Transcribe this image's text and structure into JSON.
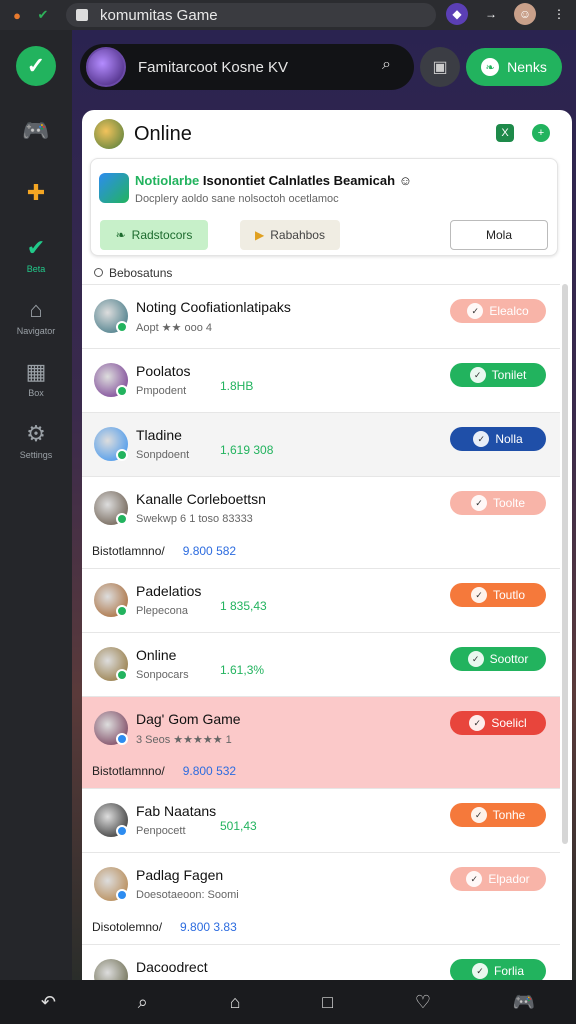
{
  "browser": {
    "url": "komumitas Game",
    "icons": [
      "fox-icon",
      "bird-icon",
      "lock-icon",
      "extension-icon",
      "forward-icon",
      "profile-icon",
      "kebab-icon"
    ]
  },
  "rail": {
    "items": [
      {
        "label": "",
        "icon": "check-icon"
      },
      {
        "label": "",
        "icon": "gamepad-icon"
      },
      {
        "label": "",
        "icon": "puzzle-icon"
      },
      {
        "label": "Beta",
        "icon": "check-mark-icon"
      },
      {
        "label": "Navigator",
        "icon": "home-icon"
      },
      {
        "label": "Box",
        "icon": "grid-icon"
      },
      {
        "label": "Settings",
        "icon": "gear-icon"
      }
    ]
  },
  "header": {
    "title": "Famitarcoot Kosne KV",
    "action_label": "Nenks"
  },
  "panel": {
    "title": "Online",
    "notice": {
      "title_prefix": "Notiolarbe",
      "title_rest": " Isonontiet Calnlatles Beamicah",
      "subtitle": "Docplery aoldo sane nolsoctoh ocetlamoc",
      "btn1": "Radstocors",
      "btn2": "Rabahbos",
      "btn3": "Mola"
    },
    "section_label": "Bebosatuns"
  },
  "rows": [
    {
      "title": "Noting Coofiationlatipaks",
      "sub": "Aopt ★★ ooo 4",
      "num": "",
      "btn": "Elealco",
      "btn_color": "#f8b4a8",
      "badge": "#22b35e",
      "icon": "#2e6b7a",
      "extra_label": "",
      "extra_val": "",
      "hl": ""
    },
    {
      "title": "Poolatos",
      "sub": "Pmpodent",
      "num": "1.8HB",
      "btn": "Tonilet",
      "btn_color": "#22b35e",
      "badge": "#22b35e",
      "icon": "#6b2a8a",
      "extra_label": "",
      "extra_val": "",
      "hl": ""
    },
    {
      "title": "Tladine",
      "sub": "Sonpdoent",
      "num": "1,619 308",
      "btn": "Nolla",
      "btn_color": "#1f4fa8",
      "badge": "#22b35e",
      "icon": "#2d8cf0",
      "extra_label": "",
      "extra_val": "",
      "hl": "grey"
    },
    {
      "title": "Kanalle Corleboettsn",
      "sub": "Swekwp 6 1 toso 83333",
      "num": "",
      "btn": "Toolte",
      "btn_color": "#f8b4a8",
      "badge": "#22b35e",
      "icon": "#5a4a3a",
      "extra_label": "Bistotlamnno/",
      "extra_val": "9.800 582",
      "hl": ""
    },
    {
      "title": "Padelatios",
      "sub": "Plepecona",
      "num": "1 835,43",
      "btn": "Toutlo",
      "btn_color": "#f5793b",
      "badge": "#22b35e",
      "icon": "#a05a20",
      "extra_label": "",
      "extra_val": "",
      "hl": ""
    },
    {
      "title": "Online",
      "sub": "Sonpocars",
      "num": "1.61,3%",
      "btn": "Soottor",
      "btn_color": "#22b35e",
      "badge": "#22b35e",
      "icon": "#8a6a2a",
      "extra_label": "",
      "extra_val": "",
      "hl": ""
    },
    {
      "title": "Dag' Gom Game",
      "sub": "3 Seos ★★★★★ 1",
      "num": "",
      "btn": "Soelicl",
      "btn_color": "#e8453c",
      "badge": "#2d8cf0",
      "icon": "#6a2a4a",
      "extra_label": "Bistotlamnno/",
      "extra_val": "9.800 532",
      "hl": "hl"
    },
    {
      "title": "Fab Naatans",
      "sub": "Penpocett",
      "num": "501,43",
      "btn": "Tonhe",
      "btn_color": "#f5793b",
      "badge": "#2d8cf0",
      "icon": "#1a1a1a",
      "extra_label": "",
      "extra_val": "",
      "hl": ""
    },
    {
      "title": "Padlag Fagen",
      "sub": "Doesotaeoon: Soomi",
      "num": "",
      "btn": "Elpador",
      "btn_color": "#f8b4a8",
      "badge": "#2d8cf0",
      "icon": "#b07a3a",
      "extra_label": "Disotolemno/",
      "extra_val": "9.800 3.83",
      "hl": ""
    },
    {
      "title": "Dacoodrect",
      "sub": "",
      "num": "",
      "btn": "Forlia",
      "btn_color": "#22b35e",
      "badge": "#2d8cf0",
      "icon": "#5a5a3a",
      "extra_label": "",
      "extra_val": "",
      "hl": ""
    }
  ],
  "bottom": {
    "icons": [
      "back-icon",
      "search-icon",
      "store-icon",
      "square-icon",
      "heart-icon",
      "gamepad-icon"
    ]
  },
  "colors": {
    "accent": "#22b35e",
    "blue": "#2d6cdf",
    "orange": "#f5793b",
    "highlight": "#fbc9c9"
  }
}
